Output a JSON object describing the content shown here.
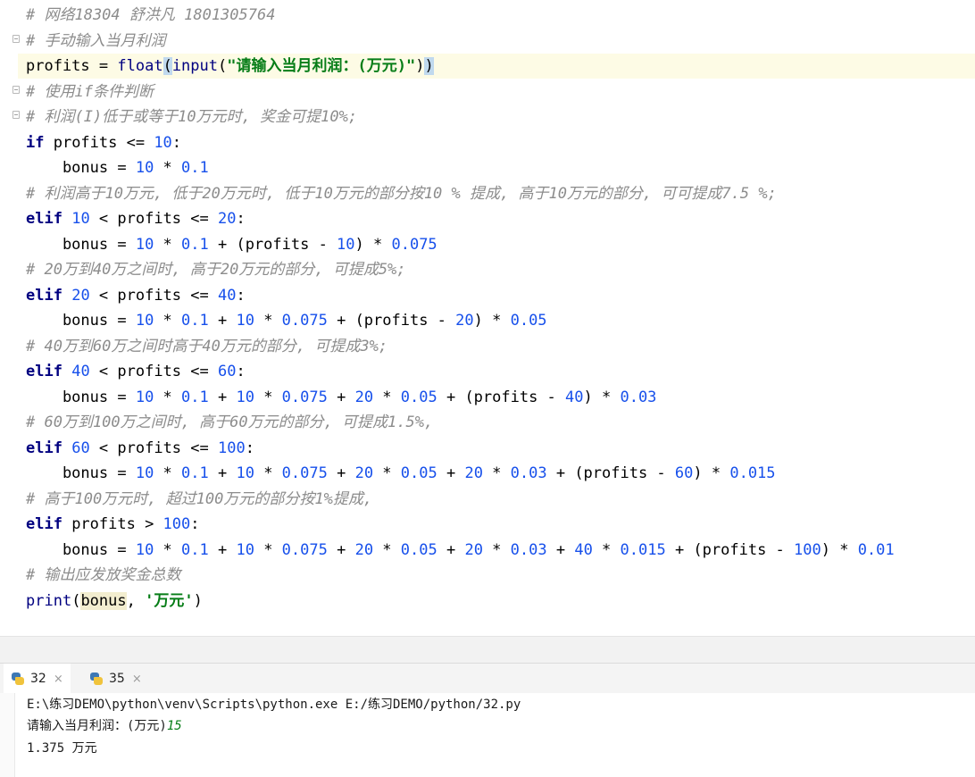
{
  "editor": {
    "lines": [
      {
        "parts": [
          {
            "t": "# 网络18304 舒洪凡 1801305764",
            "c": "cmt"
          }
        ]
      },
      {
        "parts": [
          {
            "t": "# 手动输入当月利润",
            "c": "cmt"
          }
        ]
      },
      {
        "parts": [
          {
            "t": "profits",
            "c": "id"
          },
          {
            "t": " = ",
            "c": "op"
          },
          {
            "t": "float",
            "c": "bi"
          },
          {
            "t": "(",
            "c": "op brace-hl"
          },
          {
            "t": "input",
            "c": "bi"
          },
          {
            "t": "(",
            "c": "op"
          },
          {
            "t": "\"请输入当月利润：(万元)\"",
            "c": "str"
          },
          {
            "t": ")",
            "c": "op"
          },
          {
            "t": ")",
            "c": "op brace-hl"
          }
        ]
      },
      {
        "parts": [
          {
            "t": "# 使用if条件判断",
            "c": "cmt"
          }
        ]
      },
      {
        "parts": [
          {
            "t": "# 利润(I)低于或等于10万元时, 奖金可提10%;",
            "c": "cmt"
          }
        ]
      },
      {
        "parts": [
          {
            "t": "if",
            "c": "kw"
          },
          {
            "t": " profits <= ",
            "c": "id"
          },
          {
            "t": "10",
            "c": "num"
          },
          {
            "t": ":",
            "c": "op"
          }
        ]
      },
      {
        "parts": [
          {
            "t": "    bonus = ",
            "c": "id"
          },
          {
            "t": "10",
            "c": "num"
          },
          {
            "t": " * ",
            "c": "op"
          },
          {
            "t": "0.1",
            "c": "num"
          }
        ]
      },
      {
        "parts": [
          {
            "t": "# 利润高于10万元, 低于20万元时, 低于10万元的部分按10 % 提成, 高于10万元的部分, 可可提成7.5 %;",
            "c": "cmt"
          }
        ]
      },
      {
        "parts": [
          {
            "t": "elif",
            "c": "kw"
          },
          {
            "t": " ",
            "c": "op"
          },
          {
            "t": "10",
            "c": "num"
          },
          {
            "t": " < profits <= ",
            "c": "id"
          },
          {
            "t": "20",
            "c": "num"
          },
          {
            "t": ":",
            "c": "op"
          }
        ]
      },
      {
        "parts": [
          {
            "t": "    bonus = ",
            "c": "id"
          },
          {
            "t": "10",
            "c": "num"
          },
          {
            "t": " * ",
            "c": "op"
          },
          {
            "t": "0.1",
            "c": "num"
          },
          {
            "t": " + (profits - ",
            "c": "id"
          },
          {
            "t": "10",
            "c": "num"
          },
          {
            "t": ") * ",
            "c": "op"
          },
          {
            "t": "0.075",
            "c": "num"
          }
        ]
      },
      {
        "parts": [
          {
            "t": "# 20万到40万之间时, 高于20万元的部分, 可提成5%;",
            "c": "cmt"
          }
        ]
      },
      {
        "parts": [
          {
            "t": "elif",
            "c": "kw"
          },
          {
            "t": " ",
            "c": "op"
          },
          {
            "t": "20",
            "c": "num"
          },
          {
            "t": " < profits <= ",
            "c": "id"
          },
          {
            "t": "40",
            "c": "num"
          },
          {
            "t": ":",
            "c": "op"
          }
        ]
      },
      {
        "parts": [
          {
            "t": "    bonus = ",
            "c": "id"
          },
          {
            "t": "10",
            "c": "num"
          },
          {
            "t": " * ",
            "c": "op"
          },
          {
            "t": "0.1",
            "c": "num"
          },
          {
            "t": " + ",
            "c": "op"
          },
          {
            "t": "10",
            "c": "num"
          },
          {
            "t": " * ",
            "c": "op"
          },
          {
            "t": "0.075",
            "c": "num"
          },
          {
            "t": " + (profits - ",
            "c": "id"
          },
          {
            "t": "20",
            "c": "num"
          },
          {
            "t": ") * ",
            "c": "op"
          },
          {
            "t": "0.05",
            "c": "num"
          }
        ]
      },
      {
        "parts": [
          {
            "t": "# 40万到60万之间时高于40万元的部分, 可提成3%;",
            "c": "cmt"
          }
        ]
      },
      {
        "parts": [
          {
            "t": "elif",
            "c": "kw"
          },
          {
            "t": " ",
            "c": "op"
          },
          {
            "t": "40",
            "c": "num"
          },
          {
            "t": " < profits <= ",
            "c": "id"
          },
          {
            "t": "60",
            "c": "num"
          },
          {
            "t": ":",
            "c": "op"
          }
        ]
      },
      {
        "parts": [
          {
            "t": "    bonus = ",
            "c": "id"
          },
          {
            "t": "10",
            "c": "num"
          },
          {
            "t": " * ",
            "c": "op"
          },
          {
            "t": "0.1",
            "c": "num"
          },
          {
            "t": " + ",
            "c": "op"
          },
          {
            "t": "10",
            "c": "num"
          },
          {
            "t": " * ",
            "c": "op"
          },
          {
            "t": "0.075",
            "c": "num"
          },
          {
            "t": " + ",
            "c": "op"
          },
          {
            "t": "20",
            "c": "num"
          },
          {
            "t": " * ",
            "c": "op"
          },
          {
            "t": "0.05",
            "c": "num"
          },
          {
            "t": " + (profits - ",
            "c": "id"
          },
          {
            "t": "40",
            "c": "num"
          },
          {
            "t": ") * ",
            "c": "op"
          },
          {
            "t": "0.03",
            "c": "num"
          }
        ]
      },
      {
        "parts": [
          {
            "t": "# 60万到100万之间时, 高于60万元的部分, 可提成1.5%,",
            "c": "cmt"
          }
        ]
      },
      {
        "parts": [
          {
            "t": "elif",
            "c": "kw"
          },
          {
            "t": " ",
            "c": "op"
          },
          {
            "t": "60",
            "c": "num"
          },
          {
            "t": " < profits <= ",
            "c": "id"
          },
          {
            "t": "100",
            "c": "num"
          },
          {
            "t": ":",
            "c": "op"
          }
        ]
      },
      {
        "parts": [
          {
            "t": "    bonus = ",
            "c": "id"
          },
          {
            "t": "10",
            "c": "num"
          },
          {
            "t": " * ",
            "c": "op"
          },
          {
            "t": "0.1",
            "c": "num"
          },
          {
            "t": " + ",
            "c": "op"
          },
          {
            "t": "10",
            "c": "num"
          },
          {
            "t": " * ",
            "c": "op"
          },
          {
            "t": "0.075",
            "c": "num"
          },
          {
            "t": " + ",
            "c": "op"
          },
          {
            "t": "20",
            "c": "num"
          },
          {
            "t": " * ",
            "c": "op"
          },
          {
            "t": "0.05",
            "c": "num"
          },
          {
            "t": " + ",
            "c": "op"
          },
          {
            "t": "20",
            "c": "num"
          },
          {
            "t": " * ",
            "c": "op"
          },
          {
            "t": "0.03",
            "c": "num"
          },
          {
            "t": " + (profits - ",
            "c": "id"
          },
          {
            "t": "60",
            "c": "num"
          },
          {
            "t": ") * ",
            "c": "op"
          },
          {
            "t": "0.015",
            "c": "num"
          }
        ]
      },
      {
        "parts": [
          {
            "t": "# 高于100万元时, 超过100万元的部分按1%提成,",
            "c": "cmt"
          }
        ]
      },
      {
        "parts": [
          {
            "t": "elif",
            "c": "kw"
          },
          {
            "t": " profits > ",
            "c": "id"
          },
          {
            "t": "100",
            "c": "num"
          },
          {
            "t": ":",
            "c": "op"
          }
        ]
      },
      {
        "parts": [
          {
            "t": "    bonus = ",
            "c": "id"
          },
          {
            "t": "10",
            "c": "num"
          },
          {
            "t": " * ",
            "c": "op"
          },
          {
            "t": "0.1",
            "c": "num"
          },
          {
            "t": " + ",
            "c": "op"
          },
          {
            "t": "10",
            "c": "num"
          },
          {
            "t": " * ",
            "c": "op"
          },
          {
            "t": "0.075",
            "c": "num"
          },
          {
            "t": " + ",
            "c": "op"
          },
          {
            "t": "20",
            "c": "num"
          },
          {
            "t": " * ",
            "c": "op"
          },
          {
            "t": "0.05",
            "c": "num"
          },
          {
            "t": " + ",
            "c": "op"
          },
          {
            "t": "20",
            "c": "num"
          },
          {
            "t": " * ",
            "c": "op"
          },
          {
            "t": "0.03",
            "c": "num"
          },
          {
            "t": " + ",
            "c": "op"
          },
          {
            "t": "40",
            "c": "num"
          },
          {
            "t": " * ",
            "c": "op"
          },
          {
            "t": "0.015",
            "c": "num"
          },
          {
            "t": " + (profits - ",
            "c": "id"
          },
          {
            "t": "100",
            "c": "num"
          },
          {
            "t": ") * ",
            "c": "op"
          },
          {
            "t": "0.01",
            "c": "num"
          }
        ]
      },
      {
        "parts": [
          {
            "t": "# 输出应发放奖金总数",
            "c": "cmt"
          }
        ]
      },
      {
        "parts": [
          {
            "t": "print",
            "c": "bi"
          },
          {
            "t": "(",
            "c": "op"
          },
          {
            "t": "bonus",
            "c": "id hl-var"
          },
          {
            "t": ", ",
            "c": "op"
          },
          {
            "t": "'万元'",
            "c": "str"
          },
          {
            "t": ")",
            "c": "op"
          }
        ]
      }
    ]
  },
  "run_tabs": [
    {
      "label": "32",
      "close": "×"
    },
    {
      "label": "35",
      "close": "×"
    }
  ],
  "console": {
    "command": "E:\\练习DEMO\\python\\venv\\Scripts\\python.exe E:/练习DEMO/python/32.py",
    "prompt": "请输入当月利润：(万元)",
    "user_input": "15",
    "result": "1.375 万元"
  }
}
